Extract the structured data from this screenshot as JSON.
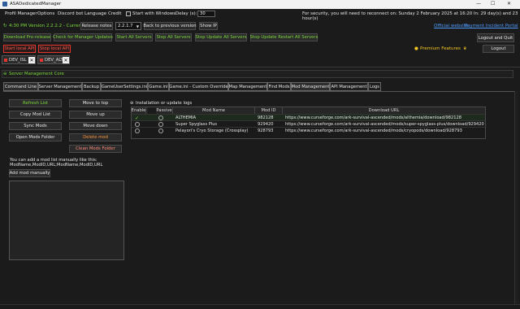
{
  "window": {
    "title": "ASADedicatedManager",
    "minimize": "—",
    "maximize": "☐",
    "close": "✕"
  },
  "menu": {
    "items": [
      "Profil Manager",
      "Options",
      "Discord bot",
      "Language",
      "Credit"
    ],
    "start_with_windows": "Start with Windows",
    "delay_label": "Delay (s):",
    "delay_value": "30"
  },
  "notice": {
    "security": "For security, you will need to reconnect on: Sunday 2 February 2025 at 16:20 In: 29 day(s) and 23 hour(s)"
  },
  "version_row": {
    "version": "4:30 PM Version 2.2.2.2 - Current",
    "release_notes": "Release notes",
    "version_select": "2.2.1.7",
    "back": "Back to previous version",
    "show_ip": "Show IP",
    "official_website": "Official website",
    "payment_portal": "Payment Incident Portal"
  },
  "toolbar": {
    "download_prerelease": "Download Pre-release",
    "check_updates": "Check for Manager Updates",
    "start_all": "Start All Servers",
    "stop_all": "Stop All Servers",
    "stop_update_all": "Stop Update All Servers",
    "stop_update_restart_all": "Stop Update Restart All Servers",
    "logout_quit": "Logout and Quit",
    "logout": "Logout",
    "premium": "Premium Features",
    "start_bot": "Start local API",
    "stop_bot": "Stop local API"
  },
  "server_tabs": [
    "DEV_ISL",
    "DEV_ALT"
  ],
  "core": {
    "title": "Server Management Core"
  },
  "page_tabs": [
    "Command Line",
    "Server Management",
    "Backup",
    "GameUserSettings.ini",
    "Game.ini",
    "Game.ini - Custom Override",
    "Map Management",
    "Find Mods",
    "Mod Management",
    "API Management",
    "Logs"
  ],
  "mods": {
    "refresh": "Refresh List",
    "copy": "Copy Mod List",
    "sync": "Sync Mods",
    "open_folder": "Open Mods Folder",
    "move_top": "Move to top",
    "move_up": "Move up",
    "move_down": "Move down",
    "delete": "Delete mod",
    "clean": "Clean Mods Folder",
    "manual_hint1": "You can add a mod list manually like this:",
    "manual_hint2": "ModName,ModID,URL;ModName,ModID,URL",
    "add_manual": "Add mod manually",
    "installation_logs": "Installation or update logs"
  },
  "grid": {
    "headers": [
      "Enable",
      "Passive",
      "Mod Name",
      "Mod ID",
      "Download URL"
    ],
    "rows": [
      {
        "enabled": true,
        "passive": false,
        "name": "ALTHEMIA",
        "id": "982128",
        "url": "https://www.curseforge.com/ark-survival-ascended/mods/althemia/download/982128"
      },
      {
        "enabled": false,
        "passive": false,
        "name": "Super Spyglass Plus",
        "id": "929420",
        "url": "https://www.curseforge.com/ark-survival-ascended/mods/super-spyglass-plus/download/929420"
      },
      {
        "enabled": false,
        "passive": false,
        "name": "Pelayori's Cryo Storage (Crossplay)",
        "id": "928793",
        "url": "https://www.curseforge.com/ark-survival-ascended/mods/cryopods/download/928793"
      }
    ]
  },
  "colors": {
    "accent_green": "#7ddc3c",
    "danger_red": "#e2362f",
    "link_blue": "#4f9bff",
    "premium_gold": "#f3c623"
  }
}
